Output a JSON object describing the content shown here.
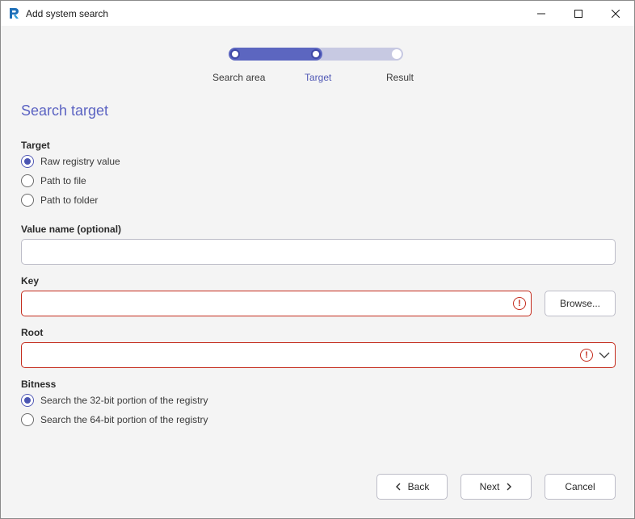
{
  "window": {
    "title": "Add system search",
    "icon": "app-logo-icon"
  },
  "stepper": {
    "steps": [
      {
        "label": "Search area",
        "state": "done"
      },
      {
        "label": "Target",
        "state": "current"
      },
      {
        "label": "Result",
        "state": "pending"
      }
    ],
    "colors": {
      "active": "#5c66c0",
      "inactive": "#c7c9e2",
      "current_label": "#5159b5"
    }
  },
  "section": {
    "title": "Search target"
  },
  "target": {
    "label": "Target",
    "options": [
      {
        "label": "Raw registry value",
        "checked": true
      },
      {
        "label": "Path to file",
        "checked": false
      },
      {
        "label": "Path to folder",
        "checked": false
      }
    ]
  },
  "value_name": {
    "label": "Value name (optional)",
    "value": ""
  },
  "key": {
    "label": "Key",
    "value": "",
    "error": true,
    "browse_label": "Browse..."
  },
  "root": {
    "label": "Root",
    "value": "",
    "error": true
  },
  "bitness": {
    "label": "Bitness",
    "options": [
      {
        "label": "Search the 32-bit portion of the registry",
        "checked": true
      },
      {
        "label": "Search the 64-bit portion of the registry",
        "checked": false
      }
    ]
  },
  "footer": {
    "back_label": "Back",
    "next_label": "Next",
    "cancel_label": "Cancel"
  },
  "colors": {
    "accent": "#5b63c2",
    "error": "#c42b1c"
  }
}
